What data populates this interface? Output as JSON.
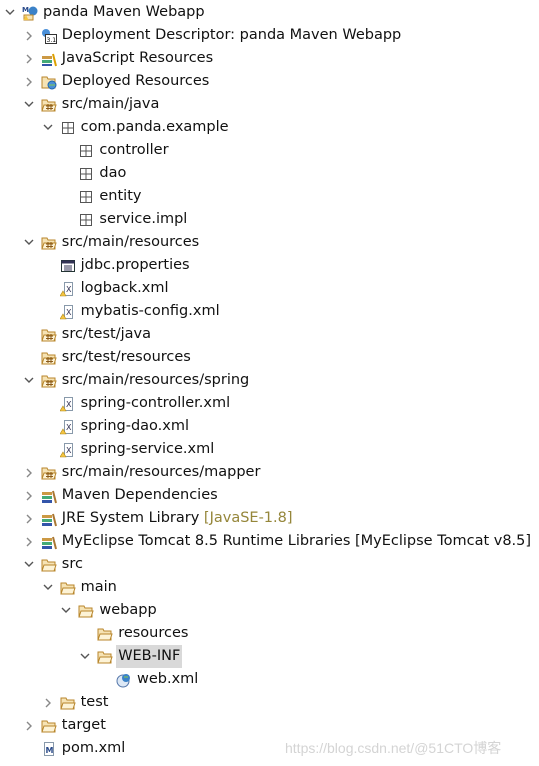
{
  "tree": [
    {
      "label": "panda Maven Webapp",
      "level": 0,
      "expanded": true,
      "icon": "maven-web-project-icon"
    },
    {
      "label": "Deployment Descriptor: panda Maven Webapp",
      "level": 1,
      "expanded": false,
      "icon": "deployment-descriptor-icon"
    },
    {
      "label": "JavaScript Resources",
      "level": 1,
      "expanded": false,
      "icon": "javascript-resources-icon"
    },
    {
      "label": "Deployed Resources",
      "level": 1,
      "expanded": false,
      "icon": "deployed-resources-icon"
    },
    {
      "label": "src/main/java",
      "level": 1,
      "expanded": true,
      "icon": "source-folder-icon"
    },
    {
      "label": "com.panda.example",
      "level": 2,
      "expanded": true,
      "icon": "package-icon"
    },
    {
      "label": "controller",
      "level": 3,
      "expanded": null,
      "icon": "package-icon"
    },
    {
      "label": "dao",
      "level": 3,
      "expanded": null,
      "icon": "package-icon"
    },
    {
      "label": "entity",
      "level": 3,
      "expanded": null,
      "icon": "package-icon"
    },
    {
      "label": "service.impl",
      "level": 3,
      "expanded": null,
      "icon": "package-icon"
    },
    {
      "label": "src/main/resources",
      "level": 1,
      "expanded": true,
      "icon": "source-folder-icon"
    },
    {
      "label": "jdbc.properties",
      "level": 2,
      "expanded": null,
      "icon": "properties-file-icon"
    },
    {
      "label": "logback.xml",
      "level": 2,
      "expanded": null,
      "icon": "xml-file-warning-icon"
    },
    {
      "label": "mybatis-config.xml",
      "level": 2,
      "expanded": null,
      "icon": "xml-file-warning-icon"
    },
    {
      "label": "src/test/java",
      "level": 1,
      "expanded": null,
      "icon": "source-folder-icon"
    },
    {
      "label": "src/test/resources",
      "level": 1,
      "expanded": null,
      "icon": "source-folder-icon"
    },
    {
      "label": "src/main/resources/spring",
      "level": 1,
      "expanded": true,
      "icon": "source-folder-icon"
    },
    {
      "label": "spring-controller.xml",
      "level": 2,
      "expanded": null,
      "icon": "xml-file-warning-icon"
    },
    {
      "label": "spring-dao.xml",
      "level": 2,
      "expanded": null,
      "icon": "xml-file-warning-icon"
    },
    {
      "label": "spring-service.xml",
      "level": 2,
      "expanded": null,
      "icon": "xml-file-warning-icon"
    },
    {
      "label": "src/main/resources/mapper",
      "level": 1,
      "expanded": false,
      "icon": "source-folder-icon"
    },
    {
      "label": "Maven Dependencies",
      "level": 1,
      "expanded": false,
      "icon": "library-icon"
    },
    {
      "label": "JRE System Library",
      "suffix": "[JavaSE-1.8]",
      "level": 1,
      "expanded": false,
      "icon": "library-icon"
    },
    {
      "label": "MyEclipse Tomcat 8.5 Runtime Libraries [MyEclipse Tomcat v8.5]",
      "level": 1,
      "expanded": false,
      "icon": "library-icon"
    },
    {
      "label": "src",
      "level": 1,
      "expanded": true,
      "icon": "folder-icon"
    },
    {
      "label": "main",
      "level": 2,
      "expanded": true,
      "icon": "folder-icon"
    },
    {
      "label": "webapp",
      "level": 3,
      "expanded": true,
      "icon": "folder-icon"
    },
    {
      "label": "resources",
      "level": 4,
      "expanded": null,
      "icon": "folder-icon"
    },
    {
      "label": "WEB-INF",
      "level": 4,
      "expanded": true,
      "icon": "folder-icon",
      "selected": true
    },
    {
      "label": "web.xml",
      "level": 5,
      "expanded": null,
      "icon": "web-xml-icon"
    },
    {
      "label": "test",
      "level": 2,
      "expanded": false,
      "icon": "folder-icon"
    },
    {
      "label": "target",
      "level": 1,
      "expanded": false,
      "icon": "folder-icon"
    },
    {
      "label": "pom.xml",
      "level": 1,
      "expanded": null,
      "icon": "maven-pom-icon"
    }
  ],
  "watermark": "https://blog.csdn.net/@51CTO博客"
}
